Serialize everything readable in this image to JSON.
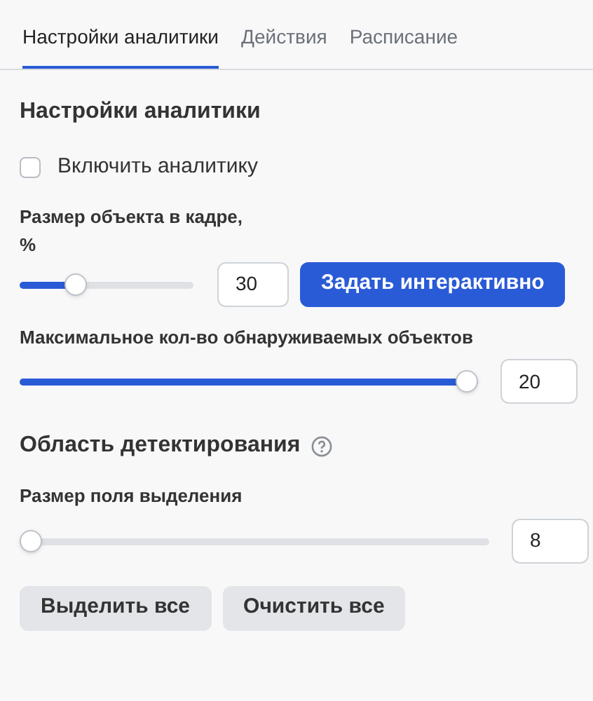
{
  "tabs": [
    {
      "label": "Настройки аналитики",
      "selected": true
    },
    {
      "label": "Действия",
      "selected": false
    },
    {
      "label": "Расписание",
      "selected": false
    }
  ],
  "section_title": "Настройки аналитики",
  "enable_checkbox": {
    "label": "Включить аналитику",
    "checked": false
  },
  "object_size": {
    "label": "Размер объекта в кадре,",
    "unit": "%",
    "level": 0.3,
    "value": "30",
    "button": "Задать интерактивно"
  },
  "max_objects": {
    "label": "Максимальное кол-во обнаруживаемых объектов",
    "level": 1.0,
    "value": "20"
  },
  "detection_area": {
    "title": "Область детектирования",
    "help": true
  },
  "selection_size": {
    "label": "Размер поля выделения",
    "level": 0.0,
    "value": "8"
  },
  "buttons": [
    "Выделить все",
    "Очистить все"
  ]
}
